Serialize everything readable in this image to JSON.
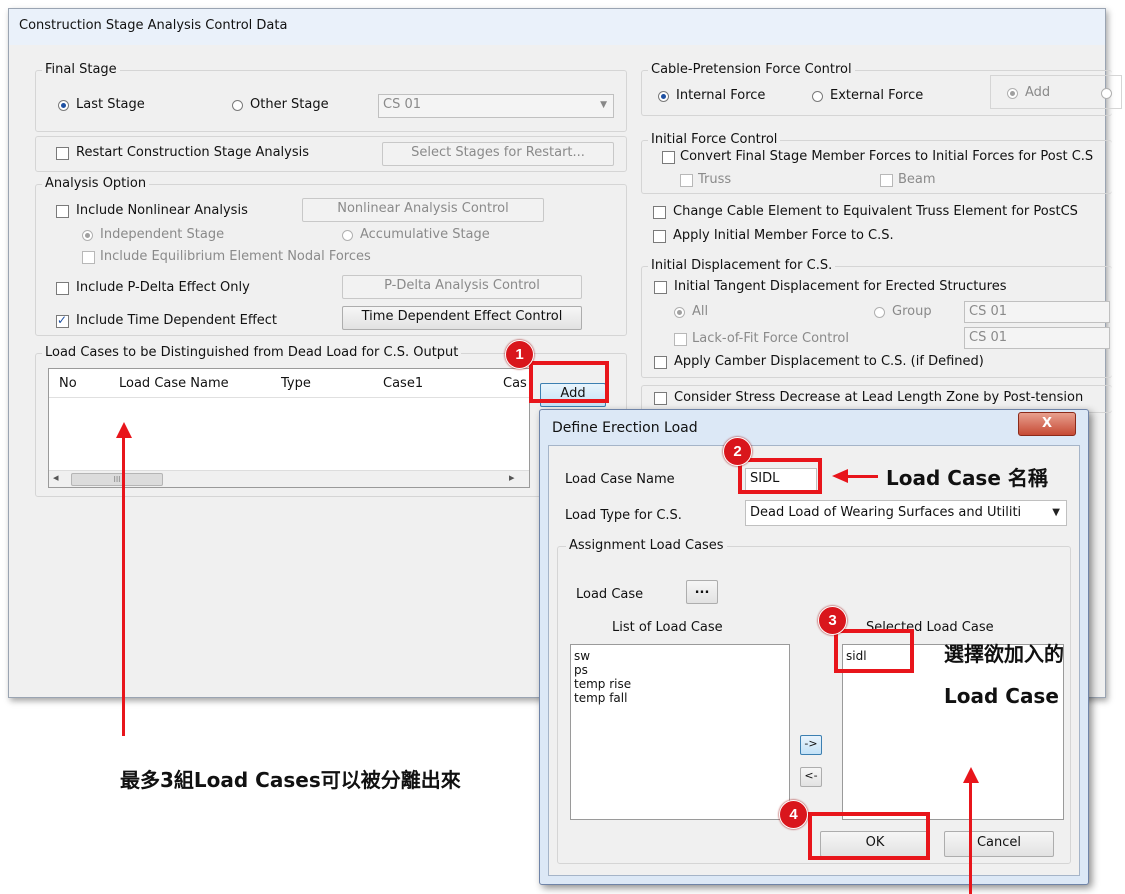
{
  "main_window": {
    "title": "Construction Stage Analysis Control Data",
    "final_stage": {
      "label": "Final Stage",
      "last_stage": "Last Stage",
      "other_stage": "Other Stage",
      "stage_select": "CS 01"
    },
    "restart": {
      "label": "Restart Construction Stage Analysis",
      "button": "Select Stages for Restart..."
    },
    "analysis_option": {
      "label": "Analysis Option",
      "nonlinear": "Include Nonlinear Analysis",
      "nonlinear_button": "Nonlinear Analysis Control",
      "independent": "Independent Stage",
      "accumulative": "Accumulative Stage",
      "equilibrium": "Include Equilibrium Element Nodal Forces",
      "pdelta": "Include P-Delta Effect Only",
      "pdelta_button": "P-Delta Analysis Control",
      "time_dependent": "Include Time Dependent Effect",
      "time_dependent_button": "Time Dependent Effect Control"
    },
    "load_cases_group": {
      "label": "Load Cases to be Distinguished from Dead Load for C.S. Output",
      "columns": [
        "No",
        "Load Case Name",
        "Type",
        "Case1",
        "Cas"
      ],
      "add_button": "Add",
      "scroll_left": "◂",
      "scroll_right": "▸",
      "scroll_grip": "III"
    },
    "cable_pretension": {
      "label": "Cable-Pretension Force Control",
      "internal": "Internal Force",
      "external": "External Force",
      "add": "Add"
    },
    "initial_force": {
      "label": "Initial Force Control",
      "convert": "Convert Final Stage Member Forces to Initial Forces for Post C.S",
      "truss": "Truss",
      "beam": "Beam",
      "change_cable": "Change Cable Element to Equivalent Truss Element for PostCS",
      "apply_initial": "Apply Initial Member Force to C.S."
    },
    "initial_displacement": {
      "label": "Initial Displacement for C.S.",
      "tangent": "Initial Tangent Displacement for Erected Structures",
      "all": "All",
      "group": "Group",
      "group_select_1": "CS 01",
      "lack_of_fit": "Lack-of-Fit Force Control",
      "group_select_2": "CS 01",
      "camber": "Apply Camber Displacement to C.S. (if Defined)"
    },
    "stress_decrease": "Consider Stress Decrease at Lead Length Zone by Post-tension"
  },
  "dialog": {
    "title": "Define Erection Load",
    "close": "X",
    "load_case_name_label": "Load Case Name",
    "load_case_name_value": "SIDL",
    "load_type_label": "Load Type for C.S.",
    "load_type_value": "Dead Load of Wearing Surfaces and Utiliti",
    "assignment_label": "Assignment Load Cases",
    "load_case_label": "Load Case",
    "load_case_button": "...",
    "list_label": "List of Load Case",
    "list_items": [
      "sw",
      "ps",
      "temp rise",
      "temp fall"
    ],
    "selected_label": "Selected Load Case",
    "selected_items": [
      "sidl"
    ],
    "move_right": "->",
    "move_left": "<-",
    "ok": "OK",
    "cancel": "Cancel"
  },
  "annotations": {
    "badges": [
      "1",
      "2",
      "3",
      "4"
    ],
    "note_load_case_name": "Load Case 名稱",
    "note_select_line1": "選擇欲加入的",
    "note_select_line2": "Load Case",
    "note_max_cases": "最多3組Load Cases可以被分離出來",
    "accent_color": "#e8151b"
  }
}
